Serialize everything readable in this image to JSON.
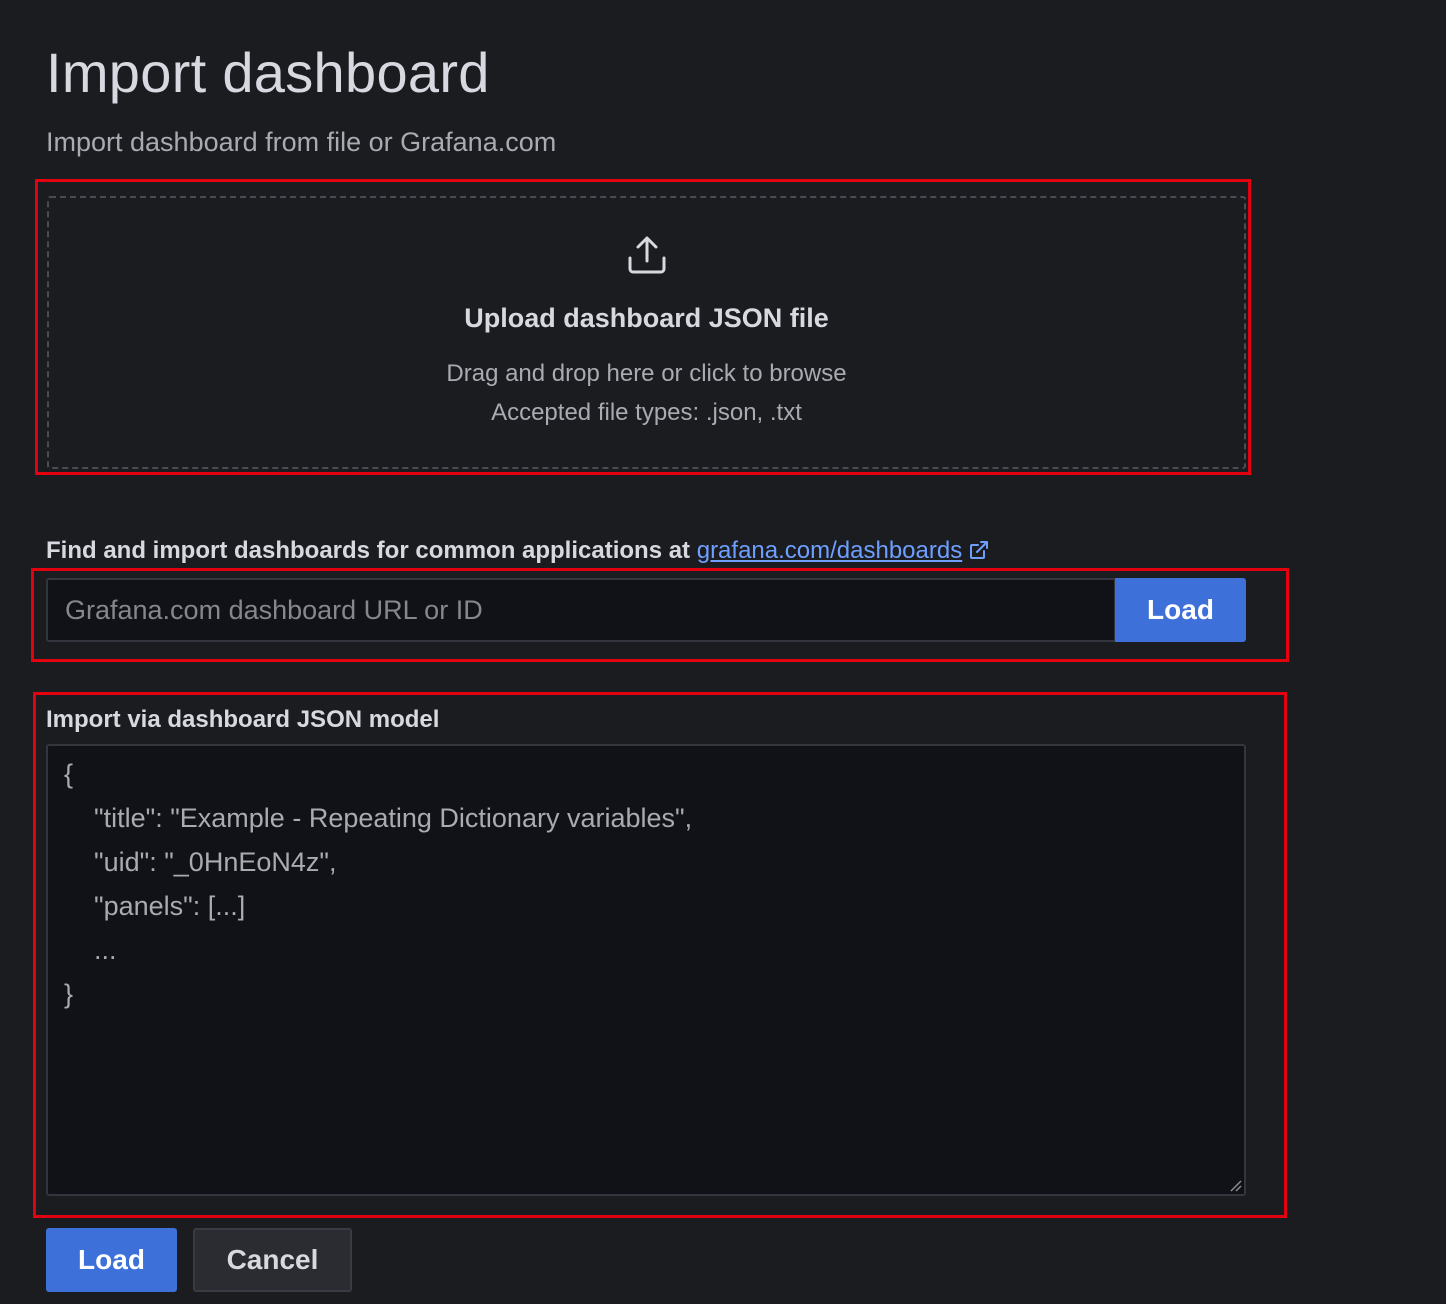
{
  "page": {
    "title": "Import dashboard",
    "subtitle": "Import dashboard from file or Grafana.com"
  },
  "upload": {
    "icon": "upload-icon",
    "title": "Upload dashboard JSON file",
    "hint": "Drag and drop here or click to browse",
    "accepted": "Accepted file types: .json, .txt"
  },
  "grafana_com": {
    "label": "Find and import dashboards for common applications at ",
    "link_text": "grafana.com/dashboards",
    "link_icon": "external-link-icon",
    "input_value": "",
    "input_placeholder": "Grafana.com dashboard URL or ID",
    "load_label": "Load"
  },
  "json_model": {
    "label": "Import via dashboard JSON model",
    "placeholder": "{\n    \"title\": \"Example - Repeating Dictionary variables\",\n    \"uid\": \"_0HnEoN4z\",\n    \"panels\": [...]\n    ...\n}"
  },
  "footer": {
    "load_label": "Load",
    "cancel_label": "Cancel"
  },
  "colors": {
    "background": "#1b1c20",
    "primary": "#3d71d9",
    "link": "#6e9fff",
    "annotation": "#e3000f"
  }
}
